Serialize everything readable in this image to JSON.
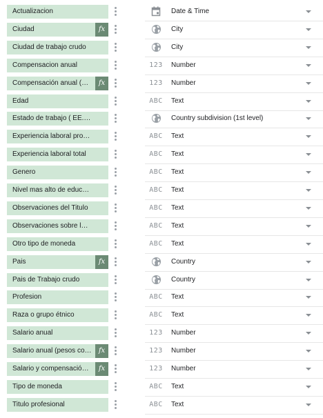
{
  "fields": [
    {
      "name": "Actualizacion",
      "fx": false,
      "type_icon": "calendar-icon",
      "type_icon_text": "",
      "type": "Date & Time"
    },
    {
      "name": "Ciudad",
      "fx": true,
      "type_icon": "globe-icon",
      "type_icon_text": "",
      "type": "City"
    },
    {
      "name": "Ciudad de trabajo  crudo",
      "fx": false,
      "type_icon": "globe-icon",
      "type_icon_text": "",
      "type": "City"
    },
    {
      "name": "Compensacion anual",
      "fx": false,
      "type_icon": "number-icon",
      "type_icon_text": "123",
      "type": "Number"
    },
    {
      "name": "Compensación anual (pe...",
      "fx": true,
      "type_icon": "number-icon",
      "type_icon_text": "123",
      "type": "Number"
    },
    {
      "name": "Edad",
      "fx": false,
      "type_icon": "text-icon",
      "type_icon_text": "ABC",
      "type": "Text"
    },
    {
      "name": "Estado de trabajo ( EE. U...",
      "fx": false,
      "type_icon": "globe-icon",
      "type_icon_text": "",
      "type": "Country subdivision (1st level)"
    },
    {
      "name": "Experiencia laboral profes...",
      "fx": false,
      "type_icon": "text-icon",
      "type_icon_text": "ABC",
      "type": "Text"
    },
    {
      "name": "Experiencia laboral total",
      "fx": false,
      "type_icon": "text-icon",
      "type_icon_text": "ABC",
      "type": "Text"
    },
    {
      "name": "Genero",
      "fx": false,
      "type_icon": "text-icon",
      "type_icon_text": "ABC",
      "type": "Text"
    },
    {
      "name": "Nivel mas alto de educaci...",
      "fx": false,
      "type_icon": "text-icon",
      "type_icon_text": "ABC",
      "type": "Text"
    },
    {
      "name": "Observaciones del Titulo",
      "fx": false,
      "type_icon": "text-icon",
      "type_icon_text": "ABC",
      "type": "Text"
    },
    {
      "name": "Observaciones sobre los i...",
      "fx": false,
      "type_icon": "text-icon",
      "type_icon_text": "ABC",
      "type": "Text"
    },
    {
      "name": "Otro tipo de moneda",
      "fx": false,
      "type_icon": "text-icon",
      "type_icon_text": "ABC",
      "type": "Text"
    },
    {
      "name": "Pais",
      "fx": true,
      "type_icon": "globe-icon",
      "type_icon_text": "",
      "type": "Country"
    },
    {
      "name": "Pais de Trabajo crudo",
      "fx": false,
      "type_icon": "globe-icon",
      "type_icon_text": "",
      "type": "Country"
    },
    {
      "name": "Profesion",
      "fx": false,
      "type_icon": "text-icon",
      "type_icon_text": "ABC",
      "type": "Text"
    },
    {
      "name": "Raza o grupo étnico",
      "fx": false,
      "type_icon": "text-icon",
      "type_icon_text": "ABC",
      "type": "Text"
    },
    {
      "name": "Salario anual",
      "fx": false,
      "type_icon": "number-icon",
      "type_icon_text": "123",
      "type": "Number"
    },
    {
      "name": "Salario anual (pesos colo...",
      "fx": true,
      "type_icon": "number-icon",
      "type_icon_text": "123",
      "type": "Number"
    },
    {
      "name": "Salario y compensación a...",
      "fx": true,
      "type_icon": "number-icon",
      "type_icon_text": "123",
      "type": "Number"
    },
    {
      "name": "Tipo de moneda",
      "fx": false,
      "type_icon": "text-icon",
      "type_icon_text": "ABC",
      "type": "Text"
    },
    {
      "name": "Titulo profesional",
      "fx": false,
      "type_icon": "text-icon",
      "type_icon_text": "ABC",
      "type": "Text"
    }
  ],
  "fx_label": "fx",
  "colors": {
    "chip_bg": "#d0e7d6",
    "fx_badge_bg": "#6b8a74",
    "icon_gray": "#8a8f94",
    "divider": "#e6e6e6"
  }
}
